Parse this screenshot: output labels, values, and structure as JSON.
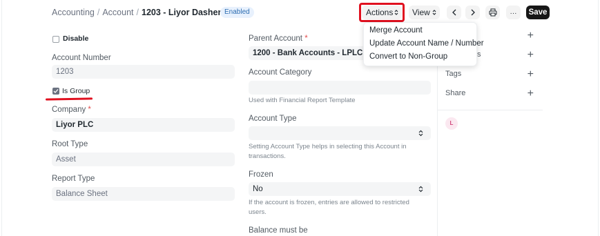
{
  "breadcrumb": {
    "items": [
      "Accounting",
      "Account"
    ],
    "current": "1203 - Liyor Dashen Bank...",
    "status": "Enabled"
  },
  "toolbar": {
    "actions_label": "Actions",
    "view_label": "View",
    "more_label": "···",
    "save_label": "Save"
  },
  "actions_menu": {
    "items": [
      "Merge Account",
      "Update Account Name / Number",
      "Convert to Non-Group"
    ]
  },
  "form": {
    "disable_label": "Disable",
    "account_number_label": "Account Number",
    "account_number_value": "1203",
    "is_group_label": "Is Group",
    "company_label": "Company",
    "company_value": "Liyor PLC",
    "root_type_label": "Root Type",
    "root_type_value": "Asset",
    "report_type_label": "Report Type",
    "report_type_value": "Balance Sheet",
    "parent_account_label": "Parent Account",
    "parent_account_value": "1200 - Bank Accounts - LPLC",
    "account_category_label": "Account Category",
    "account_category_value": "",
    "account_category_hint": "Used with Financial Report Template",
    "account_type_label": "Account Type",
    "account_type_value": "",
    "account_type_hint_1": "Setting Account Type helps in selecting this Account in",
    "account_type_hint_2": "transactions.",
    "frozen_label": "Frozen",
    "frozen_value": "No",
    "frozen_hint_1": "If the account is frozen, entries are allowed to restricted",
    "frozen_hint_2": "users.",
    "balance_label": "Balance must be",
    "required_mark": "*"
  },
  "sidebar": {
    "row1_suffix": "o",
    "row2_suffix": "ts",
    "tags_label": "Tags",
    "share_label": "Share",
    "avatar_initial": "L"
  },
  "colors": {
    "annotation_red": "#e0101f",
    "save_bg": "#171717",
    "badge_bg": "#e8f1fd"
  }
}
